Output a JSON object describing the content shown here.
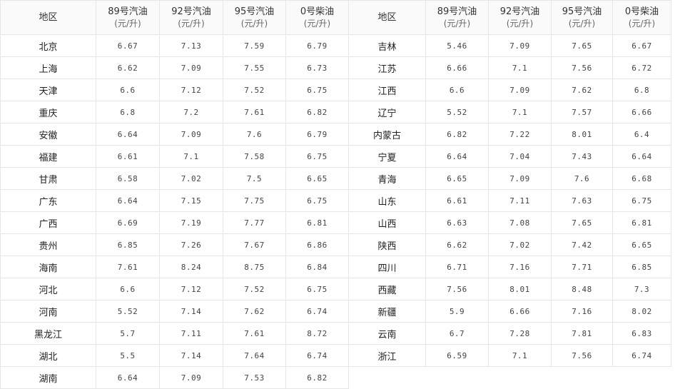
{
  "header": {
    "region": "地区",
    "fuels": [
      {
        "name": "89号汽油",
        "unit": "(元/升)"
      },
      {
        "name": "92号汽油",
        "unit": "(元/升)"
      },
      {
        "name": "95号汽油",
        "unit": "(元/升)"
      },
      {
        "name": "0号柴油",
        "unit": "(元/升)"
      }
    ]
  },
  "rows": [
    {
      "left": {
        "region": "北京",
        "values": [
          "6.67",
          "7.13",
          "7.59",
          "6.79"
        ]
      },
      "right": {
        "region": "吉林",
        "values": [
          "5.46",
          "7.09",
          "7.65",
          "6.67"
        ]
      }
    },
    {
      "left": {
        "region": "上海",
        "values": [
          "6.62",
          "7.09",
          "7.55",
          "6.73"
        ]
      },
      "right": {
        "region": "江苏",
        "values": [
          "6.66",
          "7.1",
          "7.56",
          "6.72"
        ]
      }
    },
    {
      "left": {
        "region": "天津",
        "values": [
          "6.6",
          "7.12",
          "7.52",
          "6.75"
        ]
      },
      "right": {
        "region": "江西",
        "values": [
          "6.6",
          "7.09",
          "7.62",
          "6.8"
        ]
      }
    },
    {
      "left": {
        "region": "重庆",
        "values": [
          "6.8",
          "7.2",
          "7.61",
          "6.82"
        ]
      },
      "right": {
        "region": "辽宁",
        "values": [
          "5.52",
          "7.1",
          "7.57",
          "6.66"
        ]
      }
    },
    {
      "left": {
        "region": "安徽",
        "values": [
          "6.64",
          "7.09",
          "7.6",
          "6.79"
        ]
      },
      "right": {
        "region": "内蒙古",
        "values": [
          "6.82",
          "7.22",
          "8.01",
          "6.4"
        ]
      }
    },
    {
      "left": {
        "region": "福建",
        "values": [
          "6.61",
          "7.1",
          "7.58",
          "6.75"
        ]
      },
      "right": {
        "region": "宁夏",
        "values": [
          "6.64",
          "7.04",
          "7.43",
          "6.64"
        ]
      }
    },
    {
      "left": {
        "region": "甘肃",
        "values": [
          "6.58",
          "7.02",
          "7.5",
          "6.65"
        ]
      },
      "right": {
        "region": "青海",
        "values": [
          "6.65",
          "7.09",
          "7.6",
          "6.68"
        ]
      }
    },
    {
      "left": {
        "region": "广东",
        "values": [
          "6.64",
          "7.15",
          "7.75",
          "6.75"
        ]
      },
      "right": {
        "region": "山东",
        "values": [
          "6.61",
          "7.11",
          "7.63",
          "6.75"
        ]
      }
    },
    {
      "left": {
        "region": "广西",
        "values": [
          "6.69",
          "7.19",
          "7.77",
          "6.81"
        ]
      },
      "right": {
        "region": "山西",
        "values": [
          "6.63",
          "7.08",
          "7.65",
          "6.81"
        ]
      }
    },
    {
      "left": {
        "region": "贵州",
        "values": [
          "6.85",
          "7.26",
          "7.67",
          "6.86"
        ]
      },
      "right": {
        "region": "陕西",
        "values": [
          "6.62",
          "7.02",
          "7.42",
          "6.65"
        ]
      }
    },
    {
      "left": {
        "region": "海南",
        "values": [
          "7.61",
          "8.24",
          "8.75",
          "6.84"
        ]
      },
      "right": {
        "region": "四川",
        "values": [
          "6.71",
          "7.16",
          "7.71",
          "6.85"
        ]
      }
    },
    {
      "left": {
        "region": "河北",
        "values": [
          "6.6",
          "7.12",
          "7.52",
          "6.75"
        ]
      },
      "right": {
        "region": "西藏",
        "values": [
          "7.56",
          "8.01",
          "8.48",
          "7.3"
        ]
      }
    },
    {
      "left": {
        "region": "河南",
        "values": [
          "5.52",
          "7.14",
          "7.62",
          "6.74"
        ]
      },
      "right": {
        "region": "新疆",
        "values": [
          "5.9",
          "6.66",
          "7.16",
          "8.02"
        ]
      }
    },
    {
      "left": {
        "region": "黑龙江",
        "values": [
          "5.7",
          "7.11",
          "7.61",
          "8.72"
        ]
      },
      "right": {
        "region": "云南",
        "values": [
          "6.7",
          "7.28",
          "7.81",
          "6.83"
        ]
      }
    },
    {
      "left": {
        "region": "湖北",
        "values": [
          "5.5",
          "7.14",
          "7.64",
          "6.74"
        ]
      },
      "right": {
        "region": "浙江",
        "values": [
          "6.59",
          "7.1",
          "7.56",
          "6.74"
        ]
      }
    },
    {
      "left": {
        "region": "湖南",
        "values": [
          "6.64",
          "7.09",
          "7.53",
          "6.82"
        ]
      },
      "right": null
    }
  ]
}
